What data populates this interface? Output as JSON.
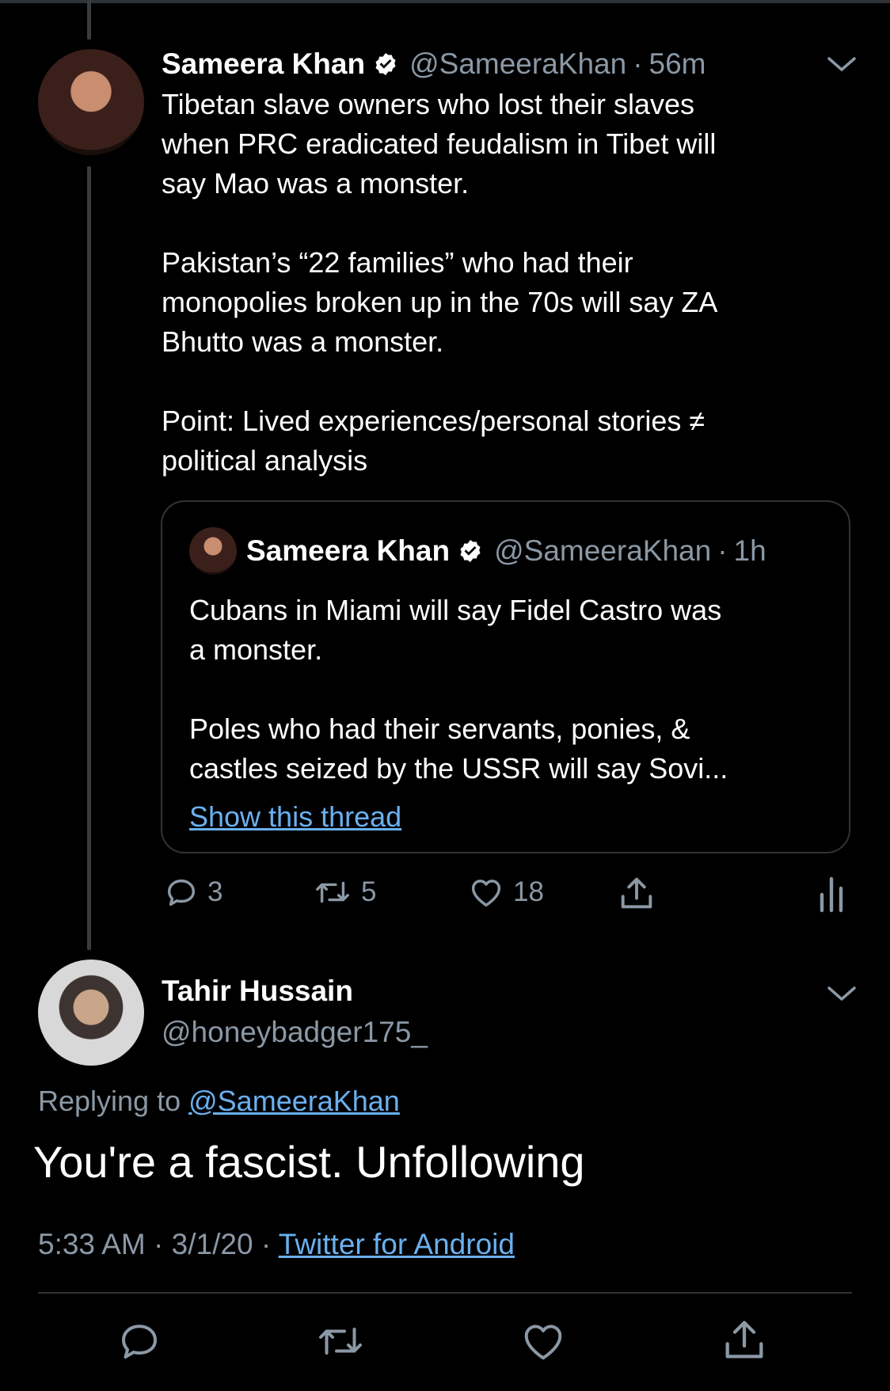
{
  "main_tweet": {
    "author_name": "Sameera Khan",
    "handle": "@SameeraKhan",
    "separator": "·",
    "time": "56m",
    "text": "Tibetan slave owners who lost their slaves\nwhen PRC eradicated feudalism in Tibet will\nsay Mao was a monster.\n\nPakistan’s “22 families” who had their\nmonopolies broken up in the 70s will say ZA\nBhutto was a monster.\n\nPoint: Lived experiences/personal stories ≠\npolitical analysis",
    "quote": {
      "author_name": "Sameera Khan",
      "handle": "@SameeraKhan",
      "separator": "·",
      "time": "1h",
      "text": "Cubans in Miami will say Fidel Castro was\na monster.\n\nPoles who had their servants, ponies, &\ncastles seized by the USSR will say Sovi...",
      "show_thread": "Show this thread"
    },
    "actions": {
      "replies": "3",
      "retweets": "5",
      "likes": "18"
    }
  },
  "reply_tweet": {
    "author_name": "Tahir Hussain",
    "handle": "@honeybadger175_",
    "replying_to_label": "Replying to",
    "replying_to_handle": "@SameeraKhan",
    "text": "You're a fascist. Unfollowing",
    "time": "5:33 AM",
    "date": "3/1/20",
    "separator": "·",
    "source": "Twitter for Android"
  },
  "icons": {
    "verified": "verified-badge-icon",
    "chevron": "chevron-down-icon",
    "reply": "reply-icon",
    "retweet": "retweet-icon",
    "like": "heart-icon",
    "share": "share-icon",
    "analytics": "analytics-icon"
  },
  "colors": {
    "background": "#000000",
    "secondary_text": "#8b98a5",
    "link": "#6ab0f0",
    "border": "#2f3336"
  }
}
